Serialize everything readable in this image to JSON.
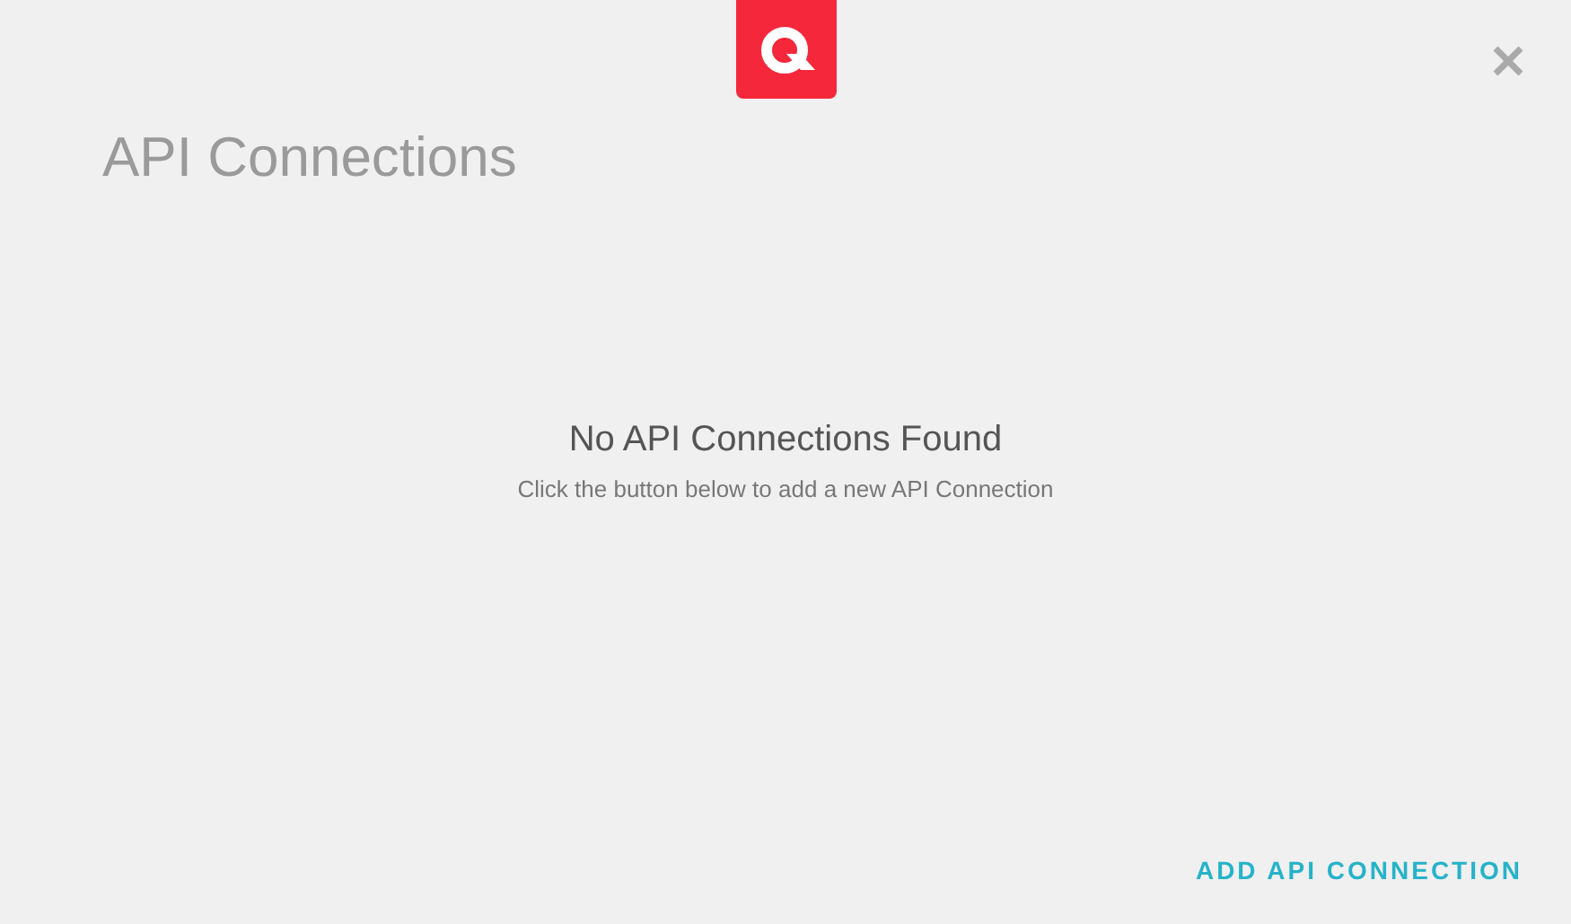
{
  "title": "API Connections",
  "empty_state": {
    "heading": "No API Connections Found",
    "message": "Click the button below to add a new API Connection"
  },
  "action": "ADD API CONNECTION"
}
